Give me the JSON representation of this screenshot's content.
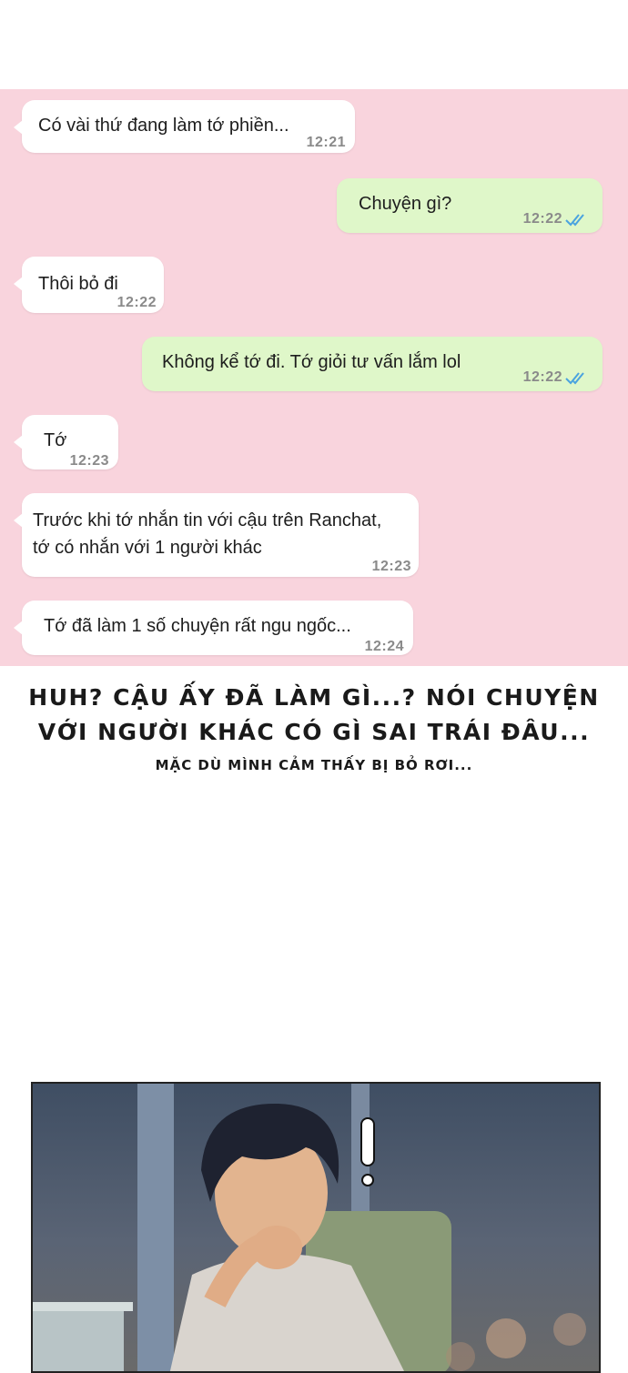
{
  "messages": [
    {
      "side": "in",
      "text": "Có vài thứ đang làm tớ phiền...",
      "time": "12:21"
    },
    {
      "side": "out",
      "text": "Chuyện gì?",
      "time": "12:22",
      "read": true
    },
    {
      "side": "in",
      "text": "Thôi bỏ đi",
      "time": "12:22"
    },
    {
      "side": "out",
      "text": "Không kể tớ đi. Tớ giỏi tư vấn lắm lol",
      "time": "12:22",
      "read": true
    },
    {
      "side": "in",
      "text": "Tớ",
      "time": "12:23"
    },
    {
      "side": "in",
      "text_lines": [
        "Trước khi tớ nhắn tin với cậu trên Ranchat,",
        "tớ có nhắn với 1 người khác"
      ],
      "time": "12:23"
    },
    {
      "side": "in",
      "text": "Tớ đã làm 1 số chuyện rất ngu ngốc...",
      "time": "12:24"
    }
  ],
  "caption": {
    "line1": "HUH? CẬU ẤY ĐÃ LÀM GÌ...? NÓI CHUYỆN",
    "line2": "VỚI NGƯỜI KHÁC CÓ GÌ SAI TRÁI ĐÂU...",
    "sub": "MẶC DÙ MÌNH CẢM THẤY BỊ BỎ RƠI..."
  },
  "colors": {
    "chat_background": "#f9d4dd",
    "incoming_bubble": "#ffffff",
    "outgoing_bubble": "#dff7c9",
    "read_ticks": "#4aa3df"
  },
  "icons": {
    "read_receipt": "double-check-icon",
    "exclamation": "exclamation-mark-icon"
  }
}
